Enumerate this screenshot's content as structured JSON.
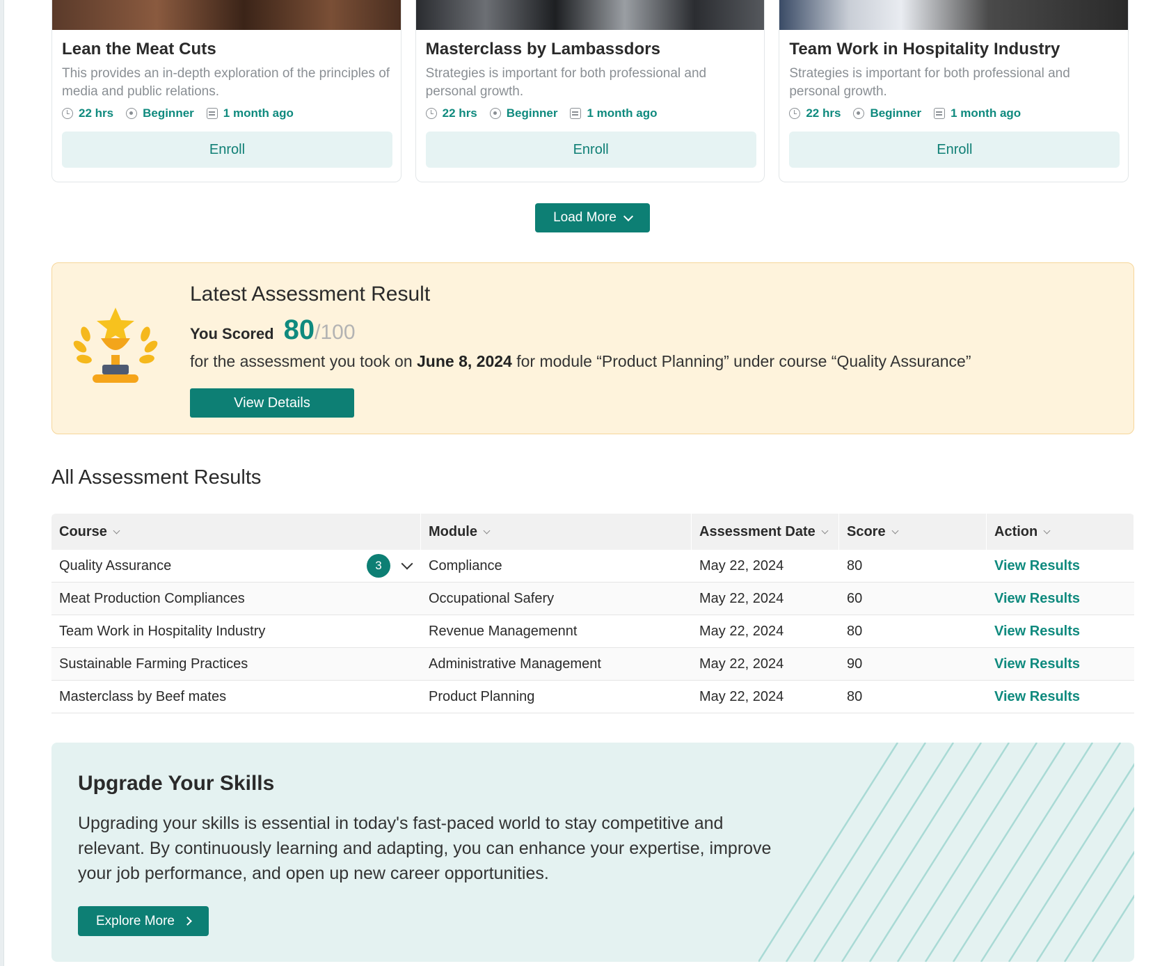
{
  "courses": [
    {
      "title": "Lean the Meat Cuts",
      "description": "This provides an in-depth exploration of the principles of media and public relations.",
      "duration": "22 hrs",
      "level": "Beginner",
      "date": "1 month ago",
      "enroll_label": "Enroll"
    },
    {
      "title": "Masterclass by Lambassdors",
      "description": "Strategies is important for both professional and personal growth.",
      "duration": "22 hrs",
      "level": "Beginner",
      "date": "1 month ago",
      "enroll_label": "Enroll"
    },
    {
      "title": "Team Work in Hospitality Industry",
      "description": "Strategies is important for both professional and personal growth.",
      "duration": "22 hrs",
      "level": "Beginner",
      "date": "1 month ago",
      "enroll_label": "Enroll"
    }
  ],
  "load_more_label": "Load More",
  "latest": {
    "title": "Latest Assessment Result",
    "scored_label": "You Scored",
    "score": "80",
    "score_total": "/100",
    "desc_prefix": "for the assessment you took on",
    "desc_date": "June 8, 2024",
    "desc_suffix": "for module “Product Planning” under course “Quality Assurance”",
    "button_label": "View Details"
  },
  "all_results": {
    "title": "All Assessment Results",
    "headers": [
      "Course",
      "Module",
      "Assessment Date",
      "Score",
      "Action"
    ],
    "rows": [
      {
        "course": "Quality Assurance",
        "badge": "3",
        "module": "Compliance",
        "date": "May 22, 2024",
        "score": "80",
        "action": "View Results"
      },
      {
        "course": "Meat Production Compliances",
        "module": "Occupational Safery",
        "date": "May 22, 2024",
        "score": "60",
        "action": "View Results"
      },
      {
        "course": "Team Work in Hospitality Industry",
        "module": "Revenue Managemennt",
        "date": "May 22, 2024",
        "score": "80",
        "action": "View Results"
      },
      {
        "course": "Sustainable Farming Practices",
        "module": "Administrative Management",
        "date": "May 22, 2024",
        "score": "90",
        "action": "View Results"
      },
      {
        "course": "Masterclass by Beef mates",
        "module": "Product Planning",
        "date": "May 22, 2024",
        "score": "80",
        "action": "View Results"
      }
    ]
  },
  "upgrade": {
    "title": "Upgrade Your Skills",
    "text": "Upgrading your skills is essential in today's fast-paced world to stay competitive and relevant. By continuously learning and adapting, you can enhance your expertise, improve your job performance, and open up new career opportunities.",
    "button_label": "Explore More"
  },
  "colors": {
    "primary": "#0d7f74",
    "accent_text": "#0f8a7e",
    "banner_bg": "#fef3dc",
    "upgrade_bg": "#e4f2f1"
  },
  "icons": {
    "duration": "clock-icon",
    "level": "level-icon",
    "date": "calendar-icon",
    "trophy": "trophy-icon"
  }
}
